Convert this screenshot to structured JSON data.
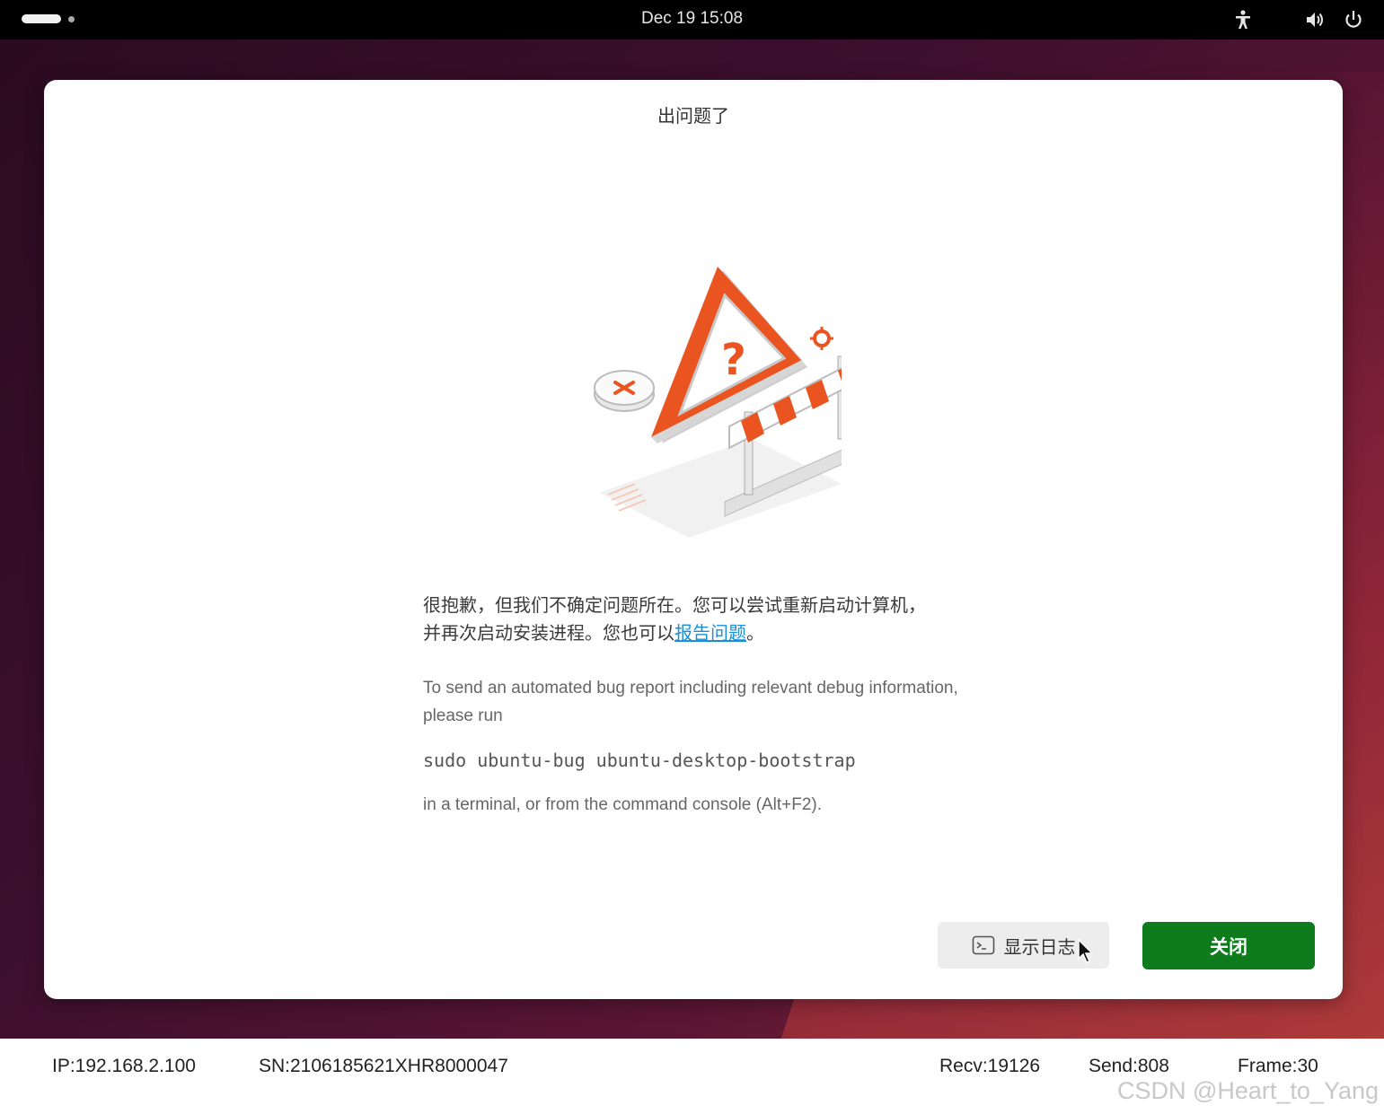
{
  "topbar": {
    "clock": "Dec 19  15:08"
  },
  "dialog": {
    "title": "出问题了",
    "message_zh_line1": "很抱歉，但我们不确定问题所在。您可以尝试重新启动计算机，",
    "message_zh_line2_prefix": "并再次启动安装进程。您也可以",
    "report_link": "报告问题",
    "message_zh_line2_suffix": "。",
    "message_en": "To send an automated bug report including relevant debug information, please run",
    "command": "sudo ubuntu-bug ubuntu-desktop-bootstrap",
    "message_en2": "in a terminal, or from the command console (Alt+F2).",
    "show_log_button": "显示日志",
    "close_button": "关闭"
  },
  "statusbar": {
    "ip": "IP:192.168.2.100",
    "sn": "SN:2106185621XHR8000047",
    "recv": "Recv:19126",
    "send": "Send:808",
    "frame": "Frame:30"
  },
  "watermark": "CSDN @Heart_to_Yang",
  "colors": {
    "accent_orange": "#e95420",
    "close_button_green": "#0e7c1c",
    "link_blue": "#1a8fd6"
  }
}
